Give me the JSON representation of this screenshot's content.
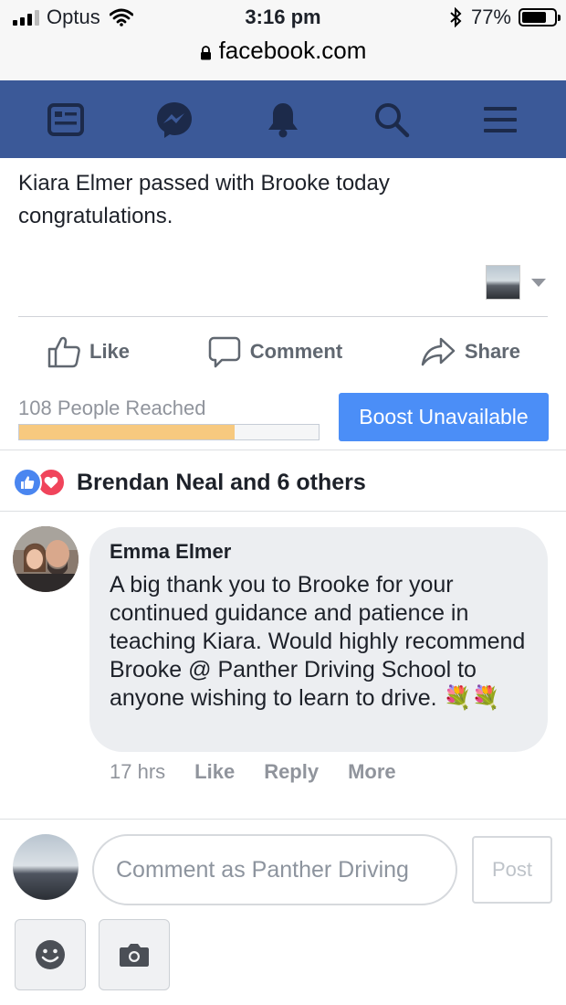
{
  "status_bar": {
    "carrier": "Optus",
    "time": "3:16 pm",
    "battery": "77%",
    "battery_level": 0.77
  },
  "browser": {
    "url": "facebook.com"
  },
  "nav": {
    "items": [
      {
        "icon": "news-feed-icon"
      },
      {
        "icon": "messenger-icon"
      },
      {
        "icon": "notifications-bell-icon"
      },
      {
        "icon": "search-icon"
      },
      {
        "icon": "menu-icon"
      }
    ]
  },
  "post": {
    "text": "Kiara Elmer passed with Brooke today congratulations.",
    "actions": {
      "like": "Like",
      "comment": "Comment",
      "share": "Share"
    },
    "reach": {
      "label": "108 People Reached",
      "progress": 0.72
    },
    "boost_label": "Boost Unavailable",
    "reactions_text": "Brendan Neal and 6 others"
  },
  "comment": {
    "author": "Emma Elmer",
    "body": "A big thank you to Brooke for your continued guidance and patience in teaching Kiara. Would highly recommend Brooke @ Panther Driving School to anyone wishing to learn to drive. 💐💐",
    "time": "17 hrs",
    "like": "Like",
    "reply": "Reply",
    "more": "More"
  },
  "composer": {
    "placeholder": "Comment as Panther Driving",
    "post_label": "Post"
  },
  "colors": {
    "fb_blue": "#3b5998",
    "boost_blue": "#4b8ef7",
    "reach_fill": "#f7c97f",
    "like_blue": "#4a86f0",
    "love_red": "#f0445b"
  }
}
